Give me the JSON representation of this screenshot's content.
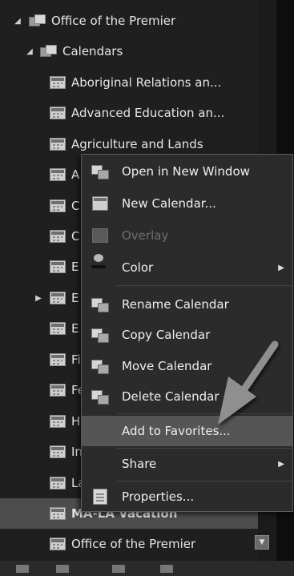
{
  "tree": {
    "root": {
      "label": "Office of the Premier"
    },
    "folder": {
      "label": "Calendars"
    },
    "items": [
      {
        "label": "Aboriginal Relations an..."
      },
      {
        "label": "Advanced Education an..."
      },
      {
        "label": "Agriculture and Lands"
      },
      {
        "label": "A"
      },
      {
        "label": "C"
      },
      {
        "label": "C"
      },
      {
        "label": "E"
      },
      {
        "label": "E"
      },
      {
        "label": "E"
      },
      {
        "label": "Fi"
      },
      {
        "label": "Fe"
      },
      {
        "label": "H"
      },
      {
        "label": "In"
      },
      {
        "label": "La"
      },
      {
        "label": "MA-LA Vacation"
      },
      {
        "label": "Office of the Premier"
      }
    ]
  },
  "context_menu": {
    "items": [
      {
        "label": "Open in New Window",
        "icon": "new-window-icon"
      },
      {
        "label": "New Calendar...",
        "icon": "calendar-icon"
      },
      {
        "label": "Overlay",
        "icon": "overlay-icon",
        "disabled": true
      },
      {
        "label": "Color",
        "icon": "color-icon",
        "submenu": true
      },
      {
        "label": "Rename Calendar",
        "icon": "rename-calendar-icon"
      },
      {
        "label": "Copy Calendar",
        "icon": "copy-calendar-icon"
      },
      {
        "label": "Move Calendar",
        "icon": "move-calendar-icon"
      },
      {
        "label": "Delete Calendar",
        "icon": "delete-calendar-icon"
      },
      {
        "label": "Add to Favorites...",
        "icon": ""
      },
      {
        "label": "Share",
        "icon": "",
        "submenu": true
      },
      {
        "label": "Properties...",
        "icon": "properties-icon"
      }
    ]
  },
  "colors": {
    "background": "#1b1b1b",
    "menu_bg": "#2b2b2b",
    "highlight": "#555555",
    "arrow": "#8f8f8f"
  }
}
